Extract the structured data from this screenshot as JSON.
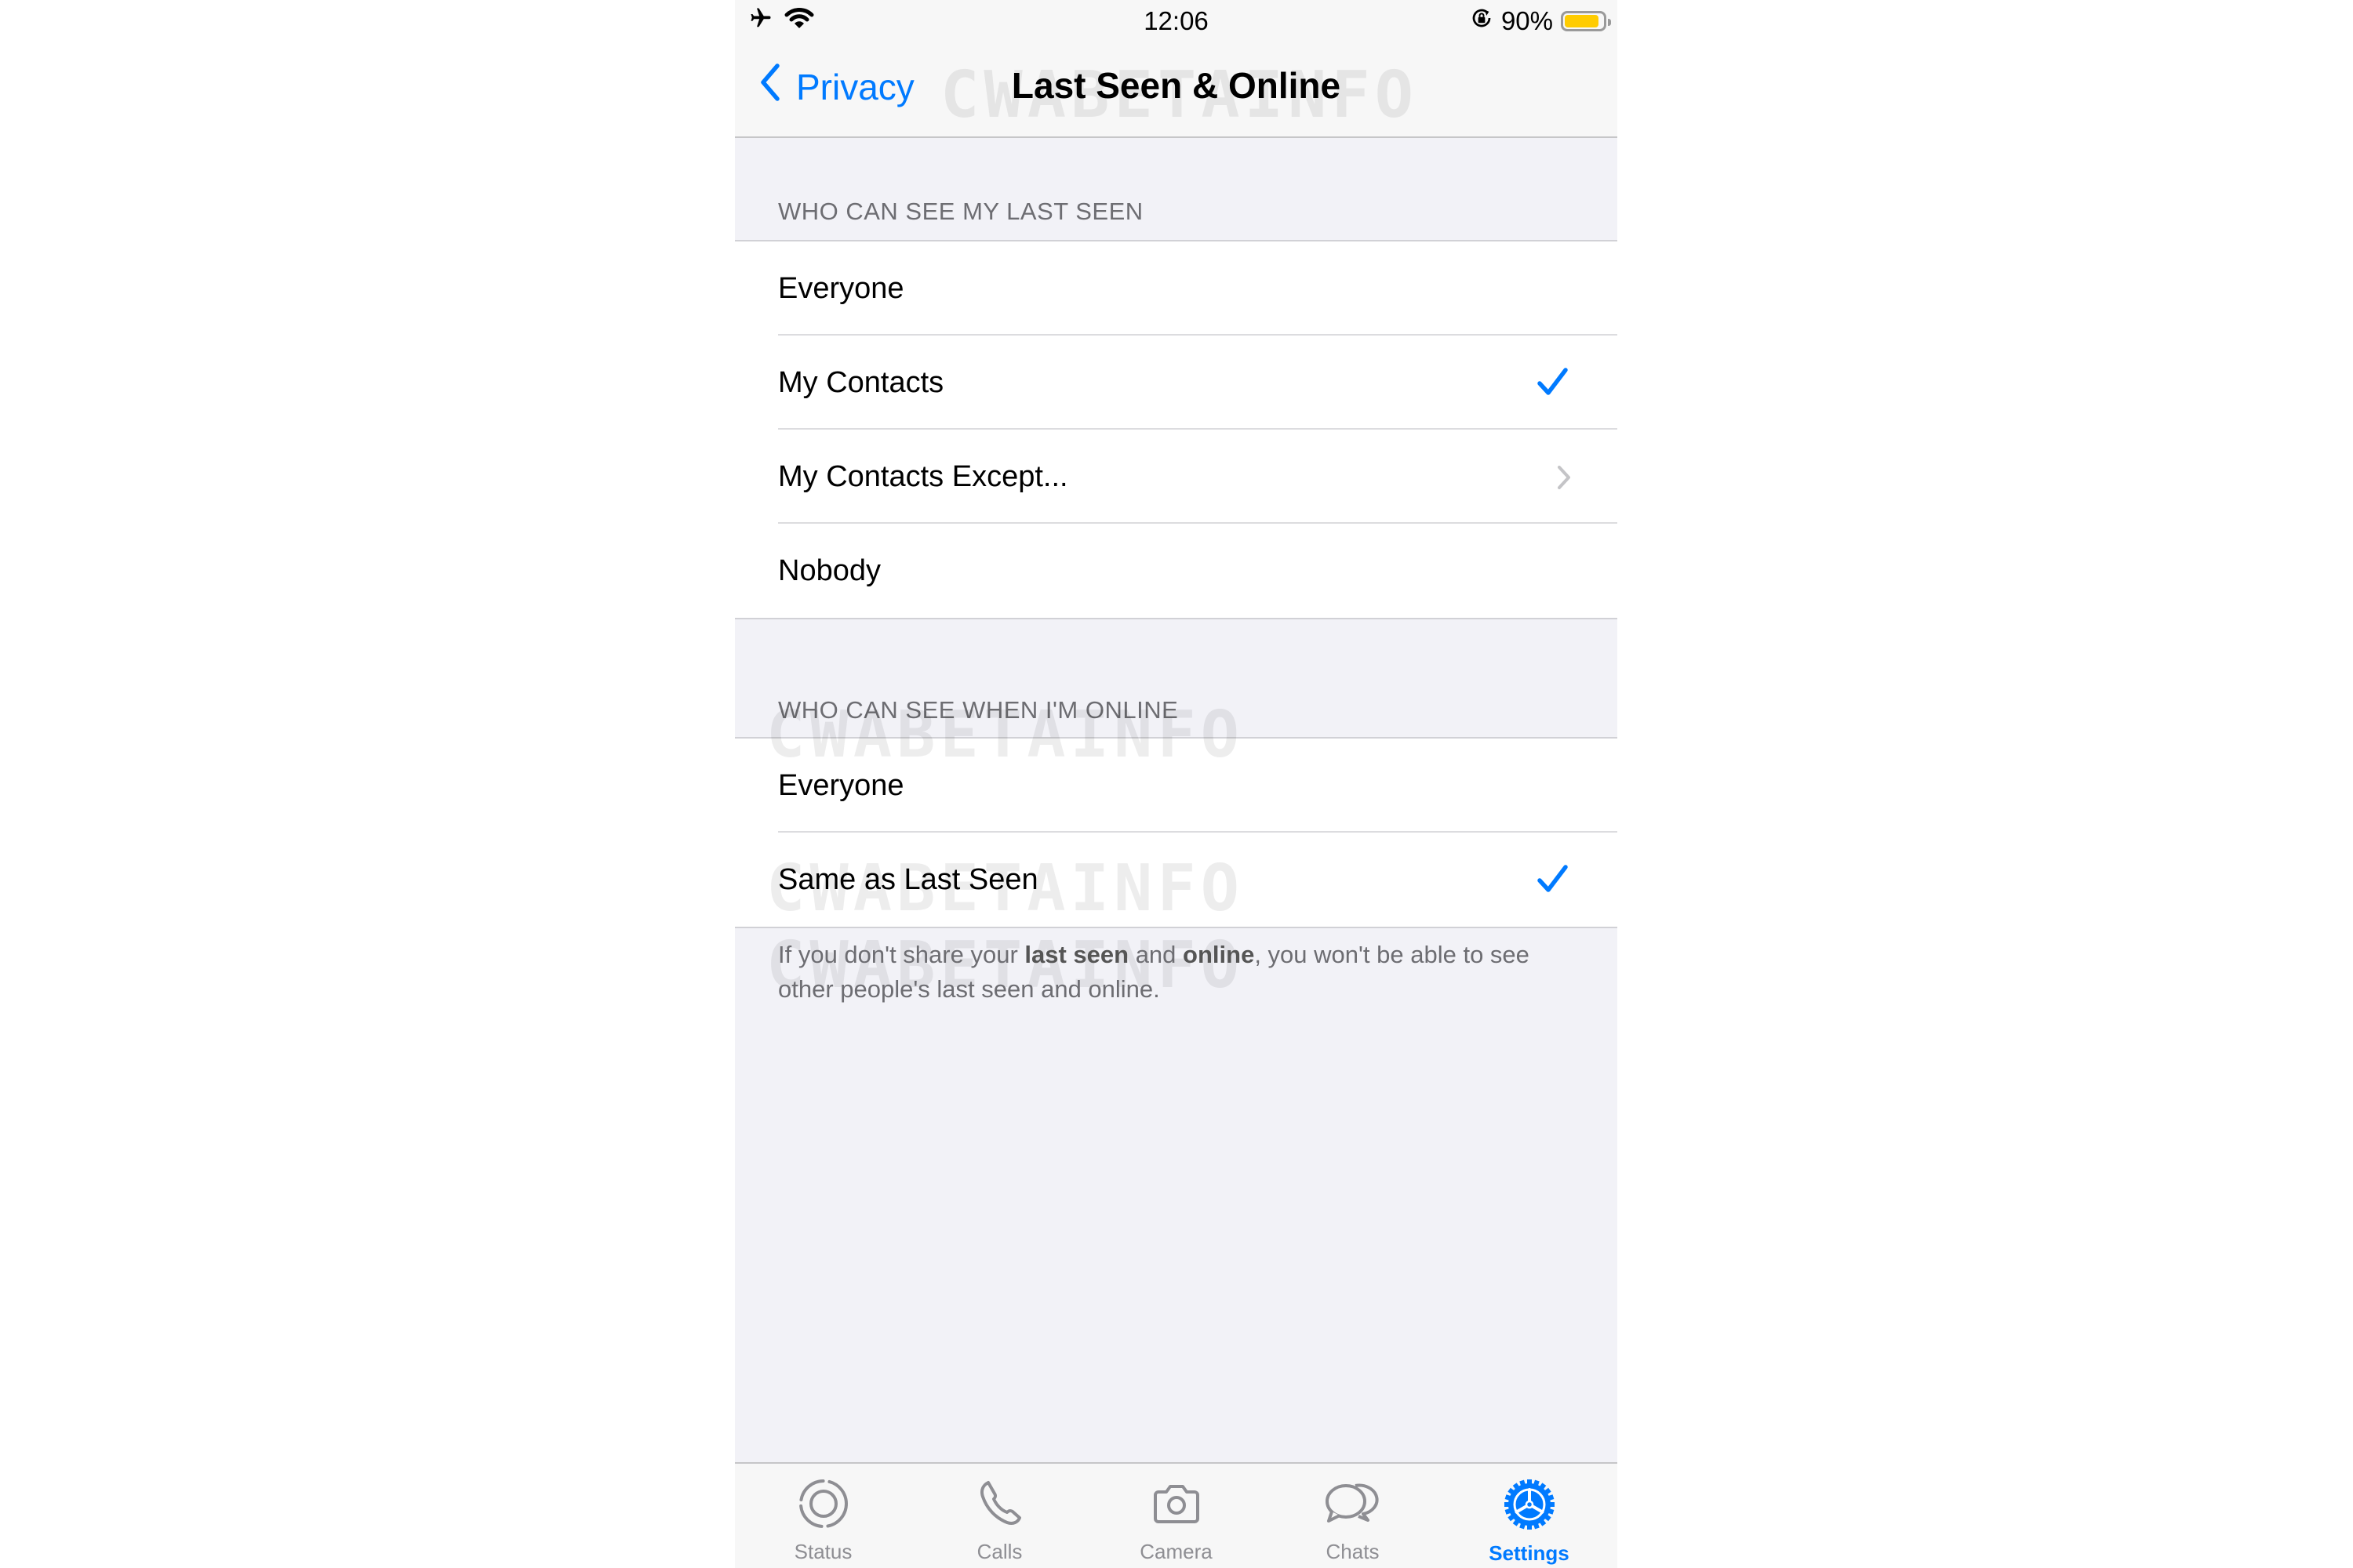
{
  "status_bar": {
    "time": "12:06",
    "battery_percent_label": "90%",
    "battery_level": 0.9,
    "icons": [
      "airplane-icon",
      "wifi-icon",
      "orientation-lock-icon",
      "battery-icon"
    ],
    "battery_color": "#ffcc00"
  },
  "nav": {
    "back_label": "Privacy",
    "title": "Last Seen & Online"
  },
  "watermark": "CWABETAINFO",
  "sections": [
    {
      "header": "WHO CAN SEE MY LAST SEEN",
      "rows": [
        {
          "label": "Everyone",
          "selected": false,
          "disclosure": false
        },
        {
          "label": "My Contacts",
          "selected": true,
          "disclosure": false
        },
        {
          "label": "My Contacts Except...",
          "selected": false,
          "disclosure": true
        },
        {
          "label": "Nobody",
          "selected": false,
          "disclosure": false
        }
      ]
    },
    {
      "header": "WHO CAN SEE WHEN I'M ONLINE",
      "rows": [
        {
          "label": "Everyone",
          "selected": false,
          "disclosure": false
        },
        {
          "label": "Same as Last Seen",
          "selected": true,
          "disclosure": false
        }
      ]
    }
  ],
  "footer": {
    "part1": "If you don't share your ",
    "bold1": "last seen",
    "part2": " and ",
    "bold2": "online",
    "part3": ", you won't be able to see other people's last seen and online."
  },
  "tabbar": {
    "tabs": [
      {
        "label": "Status",
        "icon": "status-icon",
        "active": false
      },
      {
        "label": "Calls",
        "icon": "phone-icon",
        "active": false
      },
      {
        "label": "Camera",
        "icon": "camera-icon",
        "active": false
      },
      {
        "label": "Chats",
        "icon": "chats-icon",
        "active": false
      },
      {
        "label": "Settings",
        "icon": "settings-gear-icon",
        "active": true
      }
    ]
  },
  "colors": {
    "accent": "#007aff",
    "background": "#f2f2f7",
    "bar": "#f7f7f7",
    "secondary_text": "#6d6d72",
    "inactive_tab": "#8e8e93"
  }
}
